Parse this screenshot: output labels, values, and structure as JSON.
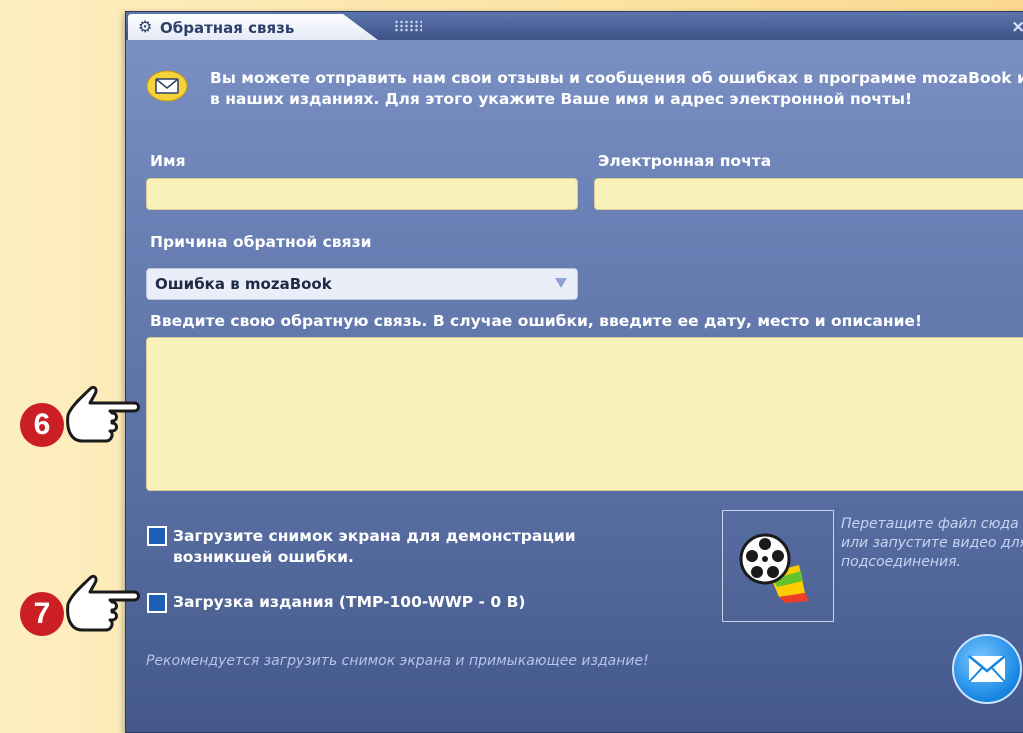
{
  "window": {
    "title": "Обратная связь",
    "close_symbol": "×",
    "intro": "Вы можете отправить нам свои отзывы и сообщения об ошибках в программе mozaBook и в наших изданиях. Для этого укажите Ваше имя и адрес электронной почты!"
  },
  "form": {
    "name_label": "Имя",
    "name_value": "",
    "email_label": "Электронная почта",
    "email_value": "",
    "reason_label": "Причина обратной связи",
    "reason_value": "Ошибка в mozaBook",
    "feedback_label": "Введите свою обратную связь. В случае ошибки, введите ее дату, место и описание!",
    "feedback_value": "",
    "screenshot_checkbox_label_1": "Загрузите снимок экрана для демонстрации",
    "screenshot_checkbox_label_2": "возникшей ошибки.",
    "edition_checkbox_label": "Загрузка издания (TMP-100-WWP - 0 B)",
    "dropzone_text": "Перетащите файл сюда или запустите видео для подсоединения.",
    "recommendation": "Рекомендуется загрузить снимок экрана и  примыкающее издание!"
  },
  "annotations": {
    "badge_6": "6",
    "badge_7": "7"
  },
  "colors": {
    "accent": "#1686e3",
    "field_bg": "#faf1ba",
    "badge": "#cc1f24"
  },
  "icons": [
    "gear-icon",
    "envelope-icon",
    "film-reel-icon",
    "send-envelope-icon",
    "pointing-hand-icon"
  ]
}
